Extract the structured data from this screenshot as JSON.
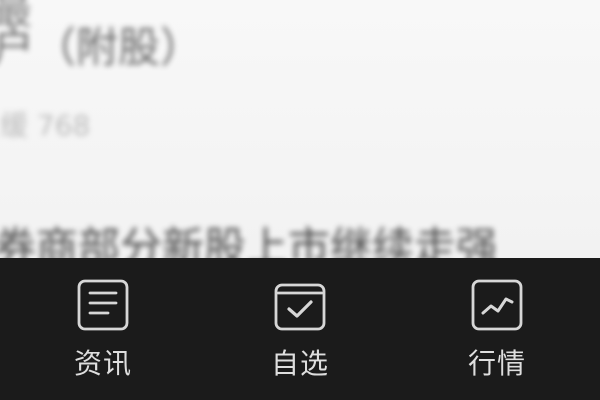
{
  "article": {
    "top_line": "最",
    "title": "户（附股）",
    "meta": "缓 768",
    "body": "券商部分新股上市继续走强"
  },
  "bottom_nav": {
    "items": [
      {
        "label": "资讯",
        "icon": "news-icon"
      },
      {
        "label": "自选",
        "icon": "checkbox-icon"
      },
      {
        "label": "行情",
        "icon": "market-trend-icon"
      }
    ]
  },
  "colors": {
    "content_background": "#f5f5f5",
    "navbar_background": "#1b1b1b",
    "navbar_foreground": "#d9d9d9"
  }
}
